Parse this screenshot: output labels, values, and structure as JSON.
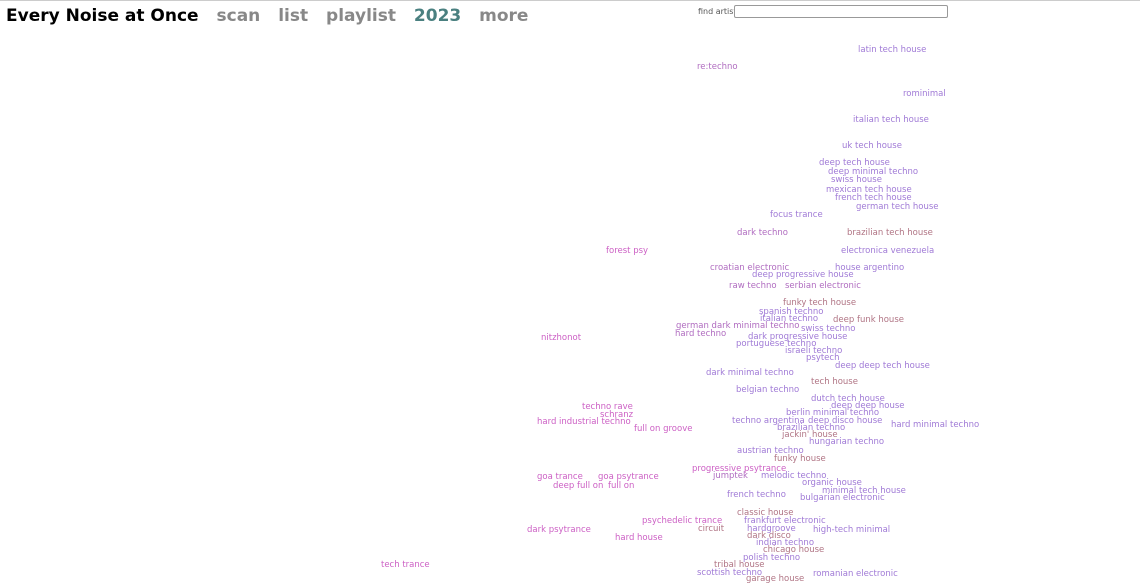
{
  "header": {
    "title": "Every Noise at Once",
    "links": [
      "scan",
      "list",
      "playlist"
    ],
    "year": "2023",
    "more": "more",
    "year_color": "#4a8080"
  },
  "search": {
    "label": "find artist",
    "value": "",
    "placeholder": ""
  },
  "colors": {
    "techno": "#a07ad6",
    "trance": "#cc5fc4",
    "house": "#b07484",
    "mid": "#b06cc0"
  },
  "genres": [
    {
      "name": "latin tech house",
      "c": "techno"
    },
    {
      "name": "re:techno",
      "c": "mid"
    },
    {
      "name": "rominimal",
      "c": "techno"
    },
    {
      "name": "italian tech house",
      "c": "techno"
    },
    {
      "name": "uk tech house",
      "c": "techno"
    },
    {
      "name": "deep tech house",
      "c": "techno"
    },
    {
      "name": "deep minimal techno",
      "c": "techno"
    },
    {
      "name": "swiss house",
      "c": "techno"
    },
    {
      "name": "mexican tech house",
      "c": "techno"
    },
    {
      "name": "french tech house",
      "c": "techno"
    },
    {
      "name": "german tech house",
      "c": "techno"
    },
    {
      "name": "focus trance",
      "c": "techno"
    },
    {
      "name": "dark techno",
      "c": "mid"
    },
    {
      "name": "brazilian tech house",
      "c": "house"
    },
    {
      "name": "forest psy",
      "c": "trance"
    },
    {
      "name": "electronica venezuela",
      "c": "techno"
    },
    {
      "name": "croatian electronic",
      "c": "mid"
    },
    {
      "name": "house argentino",
      "c": "techno"
    },
    {
      "name": "deep progressive house",
      "c": "techno"
    },
    {
      "name": "raw techno",
      "c": "mid"
    },
    {
      "name": "serbian electronic",
      "c": "mid"
    },
    {
      "name": "funky tech house",
      "c": "house"
    },
    {
      "name": "spanish techno",
      "c": "techno"
    },
    {
      "name": "italian techno",
      "c": "techno"
    },
    {
      "name": "deep funk house",
      "c": "house"
    },
    {
      "name": "german dark minimal techno",
      "c": "mid"
    },
    {
      "name": "swiss techno",
      "c": "techno"
    },
    {
      "name": "hard techno",
      "c": "mid"
    },
    {
      "name": "nitzhonot",
      "c": "trance"
    },
    {
      "name": "dark progressive house",
      "c": "techno"
    },
    {
      "name": "portuguese techno",
      "c": "techno"
    },
    {
      "name": "israeli techno",
      "c": "techno"
    },
    {
      "name": "psytech",
      "c": "techno"
    },
    {
      "name": "deep deep tech house",
      "c": "techno"
    },
    {
      "name": "dark minimal techno",
      "c": "techno"
    },
    {
      "name": "tech house",
      "c": "house"
    },
    {
      "name": "belgian techno",
      "c": "techno"
    },
    {
      "name": "dutch tech house",
      "c": "techno"
    },
    {
      "name": "deep deep house",
      "c": "techno"
    },
    {
      "name": "techno rave",
      "c": "trance"
    },
    {
      "name": "berlin minimal techno",
      "c": "techno"
    },
    {
      "name": "schranz",
      "c": "trance"
    },
    {
      "name": "techno argentina",
      "c": "techno"
    },
    {
      "name": "deep disco house",
      "c": "techno"
    },
    {
      "name": "hard industrial techno",
      "c": "trance"
    },
    {
      "name": "hard minimal techno",
      "c": "techno"
    },
    {
      "name": "brazilian techno",
      "c": "techno"
    },
    {
      "name": "full on groove",
      "c": "trance"
    },
    {
      "name": "jackin' house",
      "c": "house"
    },
    {
      "name": "hungarian techno",
      "c": "techno"
    },
    {
      "name": "austrian techno",
      "c": "techno"
    },
    {
      "name": "funky house",
      "c": "house"
    },
    {
      "name": "progressive psytrance",
      "c": "trance"
    },
    {
      "name": "jumptek",
      "c": "mid"
    },
    {
      "name": "melodic techno",
      "c": "techno"
    },
    {
      "name": "goa trance",
      "c": "trance"
    },
    {
      "name": "goa psytrance",
      "c": "trance"
    },
    {
      "name": "organic house",
      "c": "techno"
    },
    {
      "name": "deep full on",
      "c": "trance"
    },
    {
      "name": "full on",
      "c": "trance"
    },
    {
      "name": "minimal tech house",
      "c": "techno"
    },
    {
      "name": "french techno",
      "c": "techno"
    },
    {
      "name": "bulgarian electronic",
      "c": "techno"
    },
    {
      "name": "classic house",
      "c": "house"
    },
    {
      "name": "psychedelic trance",
      "c": "trance"
    },
    {
      "name": "frankfurt electronic",
      "c": "techno"
    },
    {
      "name": "hardgroove",
      "c": "techno"
    },
    {
      "name": "circuit",
      "c": "house"
    },
    {
      "name": "dark psytrance",
      "c": "trance"
    },
    {
      "name": "high-tech minimal",
      "c": "techno"
    },
    {
      "name": "dark disco",
      "c": "house"
    },
    {
      "name": "hard house",
      "c": "trance"
    },
    {
      "name": "indian techno",
      "c": "techno"
    },
    {
      "name": "chicago house",
      "c": "house"
    },
    {
      "name": "polish techno",
      "c": "techno"
    },
    {
      "name": "tribal house",
      "c": "house"
    },
    {
      "name": "tech trance",
      "c": "trance"
    },
    {
      "name": "scottish techno",
      "c": "techno"
    },
    {
      "name": "romanian electronic",
      "c": "techno"
    },
    {
      "name": "garage house",
      "c": "house"
    }
  ]
}
